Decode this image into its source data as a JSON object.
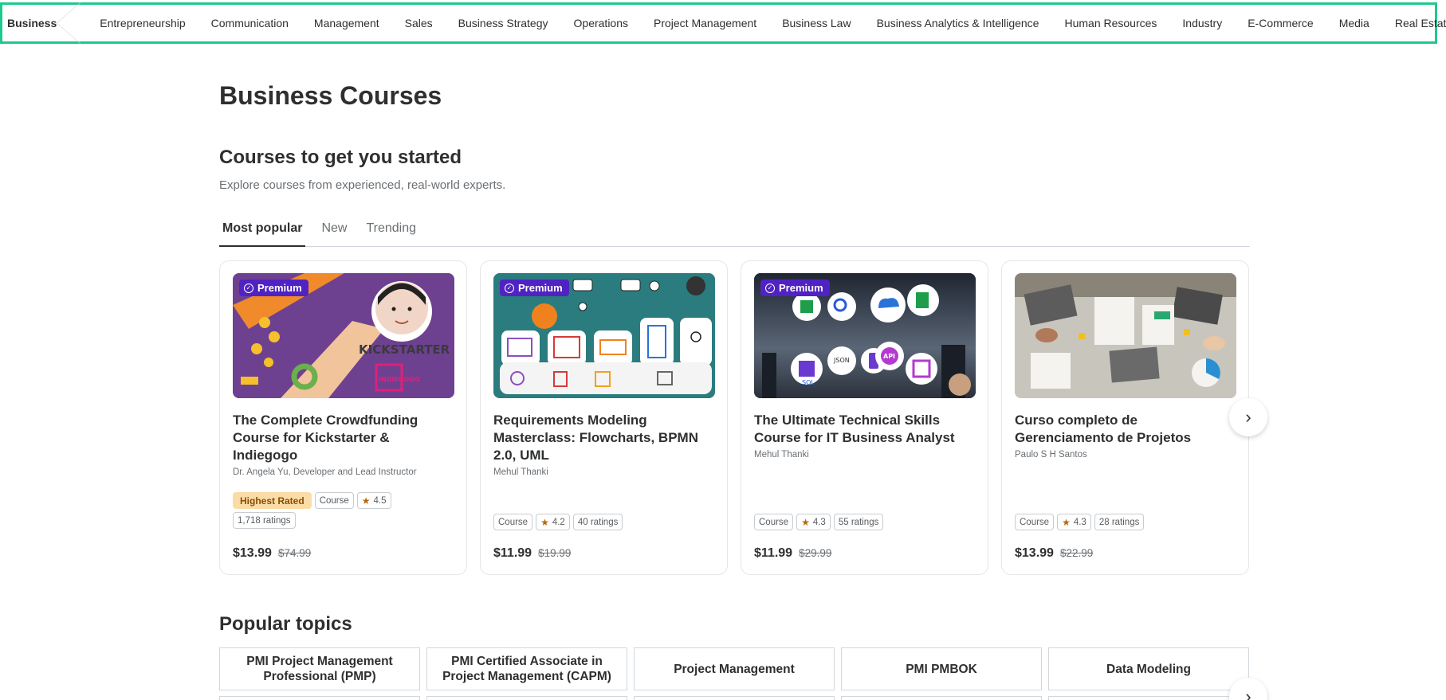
{
  "categories": {
    "active": "Business",
    "items": [
      "Entrepreneurship",
      "Communication",
      "Management",
      "Sales",
      "Business Strategy",
      "Operations",
      "Project Management",
      "Business Law",
      "Business Analytics & Intelligence",
      "Human Resources",
      "Industry",
      "E-Commerce",
      "Media",
      "Real Estate"
    ]
  },
  "page": {
    "title": "Business Courses",
    "section_title": "Courses to get you started",
    "section_subtitle": "Explore courses from experienced, real-world experts."
  },
  "tabs": [
    "Most popular",
    "New",
    "Trending"
  ],
  "premium_label": "Premium",
  "courses": [
    {
      "title": "The Complete Crowdfunding Course for Kickstarter & Indiegogo",
      "author": "Dr. Angela Yu, Developer and Lead Instructor",
      "highlight": "Highest Rated",
      "type": "Course",
      "rating": "4.5",
      "ratings": "1,718 ratings",
      "price": "$13.99",
      "old_price": "$74.99",
      "thumb_text_1": "KICKSTARTER",
      "thumb_text_2": "INDIEGOGO"
    },
    {
      "title": "Requirements Modeling Masterclass: Flowcharts, BPMN 2.0, UML",
      "author": "Mehul Thanki",
      "type": "Course",
      "rating": "4.2",
      "ratings": "40 ratings",
      "price": "$11.99",
      "old_price": "$19.99"
    },
    {
      "title": "The Ultimate Technical Skills Course for IT Business Analyst",
      "author": "Mehul Thanki",
      "type": "Course",
      "rating": "4.3",
      "ratings": "55 ratings",
      "price": "$11.99",
      "old_price": "$29.99",
      "thumb_text_1": "JSON",
      "thumb_text_2": "API",
      "thumb_text_3": "SQL"
    },
    {
      "title": "Curso completo de Gerenciamento de Projetos",
      "author": "Paulo S H Santos",
      "type": "Course",
      "rating": "4.3",
      "ratings": "28 ratings",
      "price": "$13.99",
      "old_price": "$22.99"
    }
  ],
  "topics": {
    "title": "Popular topics",
    "items": [
      "PMI Project Management Professional (PMP)",
      "PMI Certified Associate in Project Management (CAPM)",
      "Project Management",
      "PMI PMBOK",
      "Data Modeling"
    ]
  },
  "icons": {
    "next": "chevron-right-icon",
    "star": "star-icon",
    "premium": "check-badge-icon"
  },
  "colors": {
    "accent_border": "#1ec98c",
    "premium": "#5022c3",
    "star": "#b4690e",
    "highest_rated_bg": "#fbdca7"
  }
}
